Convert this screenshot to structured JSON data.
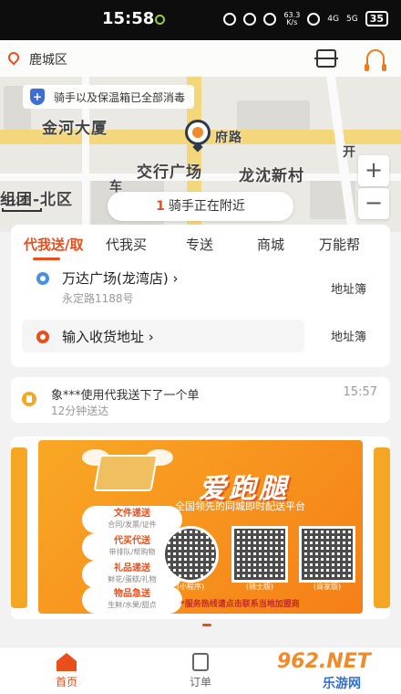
{
  "status_bar": {
    "time": "15:58",
    "network_speed": "63.3\nK/s",
    "signal_4g": "4G",
    "signal_5g": "5G",
    "battery": "35"
  },
  "header": {
    "location": "鹿城区"
  },
  "map": {
    "notice": "骑手以及保温箱已全部消毒",
    "labels": [
      "金河大厦",
      "府路",
      "交行广场",
      "龙沈新村",
      "组团-北区",
      "车",
      "开"
    ],
    "scale": "5公里",
    "zoom_in": "+",
    "zoom_out": "−",
    "nearby_count": "1",
    "nearby_text": "骑手正在附近"
  },
  "order_card": {
    "tabs": [
      "代我送/取",
      "代我买",
      "专送",
      "商城",
      "万能帮"
    ],
    "active_tab": 0,
    "pickup": {
      "title": "万达广场(龙湾店)  ›",
      "subtitle": "永定路1188号",
      "book": "地址簿"
    },
    "delivery": {
      "placeholder": "输入收货地址  ›",
      "book": "地址簿"
    }
  },
  "activity": {
    "text": "象***使用代我送下了一个单",
    "sub": "12分钟送达",
    "time": "15:57"
  },
  "banner": {
    "title": "爱跑腿",
    "subtitle": "全国领先的同城即时配送平台",
    "services": [
      {
        "title": "文件递送",
        "desc": "合同/发票/证件"
      },
      {
        "title": "代买代送",
        "desc": "带排队/帮购物"
      },
      {
        "title": "礼品递送",
        "desc": "鲜花/蛋糕/礼物"
      },
      {
        "title": "物品急送",
        "desc": "生鲜/水果/甜点"
      }
    ],
    "qr_labels": [
      "(小程序)",
      "(骑士版)",
      "(商家版)"
    ],
    "hotline": "*服务热线请点击联系当地加盟商"
  },
  "bottom_nav": {
    "home": "首页",
    "orders": "订单"
  },
  "watermark": {
    "top": "962.NET",
    "bottom": "乐游网"
  },
  "colors": {
    "accent": "#e94e1b",
    "banner": "#f9a825"
  }
}
